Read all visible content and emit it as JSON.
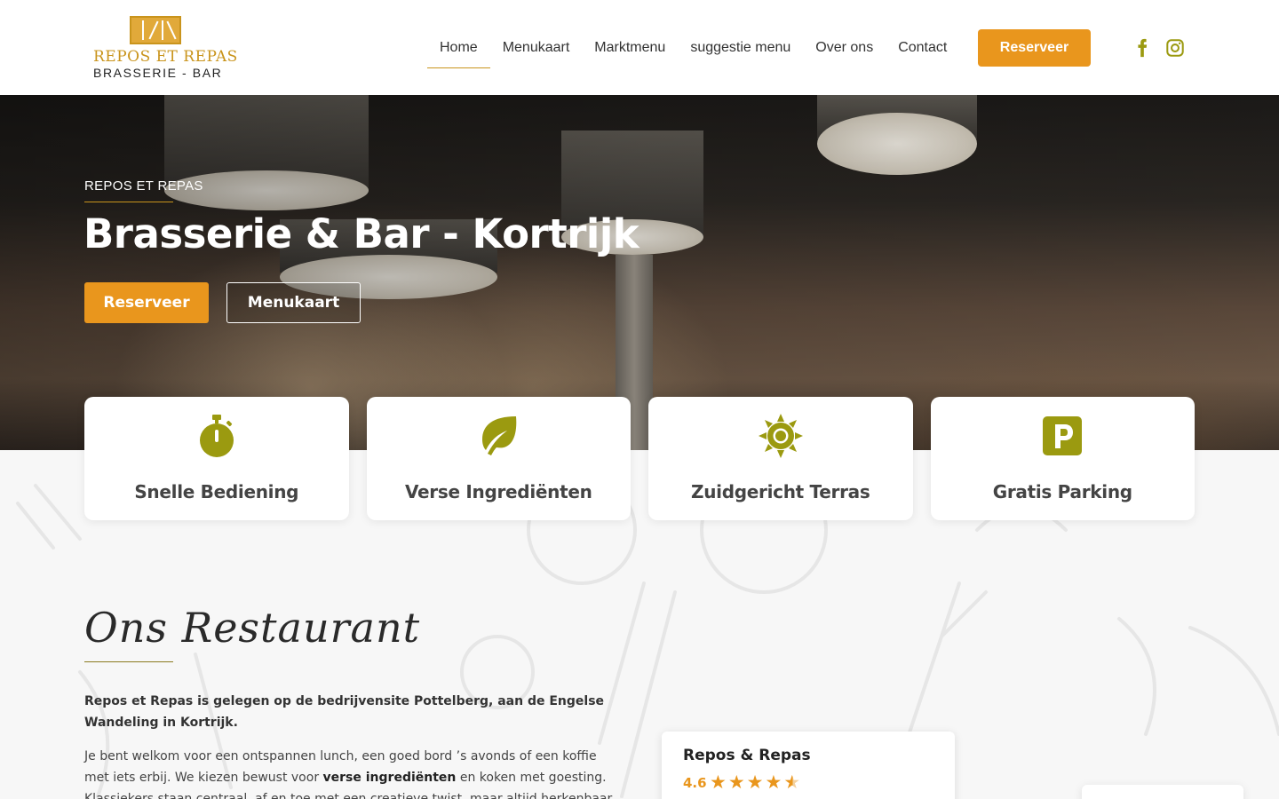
{
  "brand": {
    "name": "REPOS ET REPAS",
    "subtitle": "BRASSERIE - BAR",
    "accent": "#c9941c",
    "cta_color": "#e9961d",
    "icon_color": "#9b9a10"
  },
  "nav": {
    "items": [
      {
        "label": "Home",
        "active": true
      },
      {
        "label": "Menukaart"
      },
      {
        "label": "Marktmenu"
      },
      {
        "label": "suggestie menu"
      },
      {
        "label": "Over ons"
      },
      {
        "label": "Contact"
      }
    ],
    "reserve_label": "Reserveer",
    "social": [
      "facebook-icon",
      "instagram-icon"
    ]
  },
  "hero": {
    "kicker": "REPOS ET REPAS",
    "title": "Brasserie & Bar - Kortrijk",
    "primary_button": "Reserveer",
    "secondary_button": "Menukaart"
  },
  "features": [
    {
      "icon": "stopwatch-icon",
      "label": "Snelle Bediening"
    },
    {
      "icon": "leaf-icon",
      "label": "Verse Ingrediënten"
    },
    {
      "icon": "sun-icon",
      "label": "Zuidgericht Terras"
    },
    {
      "icon": "parking-icon",
      "label": "Gratis Parking"
    }
  ],
  "about": {
    "title": "Ons Restaurant",
    "intro": "Repos et Repas is gelegen op de bedrijvensite Pottelberg, aan de Engelse Wandeling in Kortrijk.",
    "body_part1": "Je bent welkom voor een ontspannen lunch, een goed bord ’s avonds of een koffie met iets erbij. We kiezen bewust voor ",
    "body_bold": "verse ingrediënten",
    "body_part2": " en koken met goesting. Klassiekers staan centraal, af en toe met een creatieve twist, maar altijd herkenbaar en op smaak."
  },
  "review": {
    "name": "Repos & Repas",
    "rating": "4.6",
    "stars": 4.6
  }
}
